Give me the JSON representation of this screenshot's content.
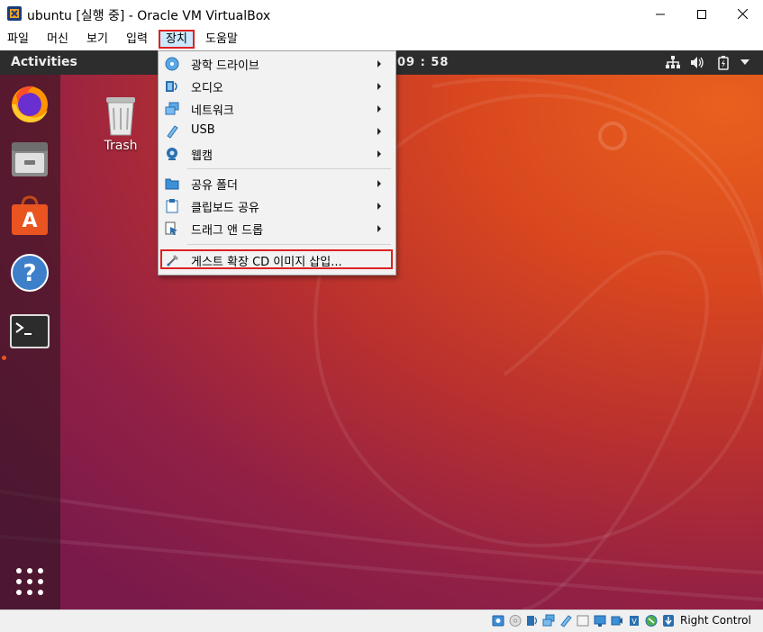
{
  "window": {
    "title": "ubuntu [실행 중] - Oracle VM VirtualBox",
    "icon": "virtualbox-icon"
  },
  "menubar": {
    "items": [
      {
        "label": "파일",
        "active": false
      },
      {
        "label": "머신",
        "active": false
      },
      {
        "label": "보기",
        "active": false
      },
      {
        "label": "입력",
        "active": false
      },
      {
        "label": "장치",
        "active": true
      },
      {
        "label": "도움말",
        "active": false
      }
    ]
  },
  "devices_menu": {
    "items": [
      {
        "label": "광학 드라이브",
        "icon": "optical-drive-icon",
        "submenu": true
      },
      {
        "label": "오디오",
        "icon": "audio-icon",
        "submenu": true
      },
      {
        "label": "네트워크",
        "icon": "network-icon",
        "submenu": true
      },
      {
        "label": "USB",
        "icon": "usb-icon",
        "submenu": true
      },
      {
        "label": "웹캠",
        "icon": "webcam-icon",
        "submenu": true
      },
      {
        "label": "공유 폴더",
        "icon": "shared-folder-icon",
        "submenu": true
      },
      {
        "label": "클립보드 공유",
        "icon": "clipboard-icon",
        "submenu": true
      },
      {
        "label": "드래그 앤 드롭",
        "icon": "drag-drop-icon",
        "submenu": true
      },
      {
        "label": "게스트 확장 CD 이미지 삽입...",
        "icon": "guest-additions-icon",
        "submenu": false,
        "highlighted": true
      }
    ]
  },
  "guest": {
    "activities_label": "Activities",
    "clock": "09 : 58",
    "desktop_icons": [
      {
        "label": "Trash",
        "icon": "trash-icon"
      }
    ],
    "dock_apps": [
      "firefox-icon",
      "files-icon",
      "software-center-icon",
      "help-icon",
      "terminal-icon"
    ],
    "tray_icons": [
      "network-wired-icon",
      "volume-icon",
      "battery-icon",
      "chevron-down-icon"
    ]
  },
  "statusbar": {
    "host_key_label": "Right Control",
    "icons": [
      "hard-disk-icon",
      "optical-disk-icon",
      "audio-icon",
      "network-icon",
      "usb-icon",
      "shared-folder-icon",
      "display-icon",
      "video-capture-icon",
      "cpu-icon",
      "mouse-integration-icon",
      "arrow-down-icon"
    ]
  },
  "colors": {
    "highlight_border": "#e02020",
    "ubuntu_orange": "#e95420",
    "menu_hover": "#cce8ff"
  }
}
